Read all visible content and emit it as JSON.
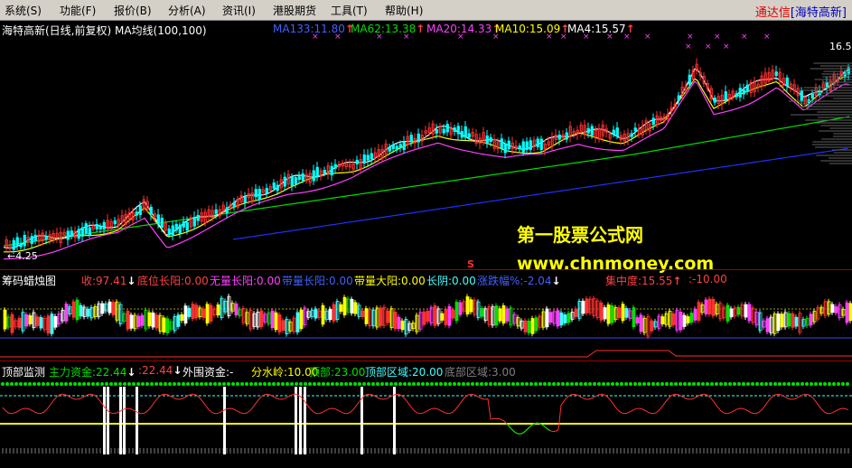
{
  "menu": {
    "items": [
      "系统(S)",
      "功能(F)",
      "报价(B)",
      "分析(A)",
      "资讯(I)",
      "港股期货",
      "工具(T)",
      "帮助(H)"
    ]
  },
  "brand": {
    "app": "通达信",
    "stock": "[海特高新]"
  },
  "main_panel": {
    "title": "海特高新(日线,前复权) MA均线(100,100)",
    "ma": [
      {
        "label": "MA133:11.80",
        "color": "#4060ff",
        "arrow": "↑"
      },
      {
        "label": "MA62:13.38",
        "color": "#00e000",
        "arrow": "↑"
      },
      {
        "label": "MA20:14.33",
        "color": "#ff40ff",
        "arrow": "↑"
      },
      {
        "label": "MA10:15.09",
        "color": "#ffff00",
        "arrow": "↑"
      },
      {
        "label": "MA4:15.57",
        "color": "#ffffff",
        "arrow": "↑"
      }
    ],
    "price_high": "16.5",
    "price_low": "4.25",
    "s_marker": "S",
    "watermark_title": "第一股票公式网",
    "watermark_url": "www.chnmoney.com"
  },
  "mid_panel": {
    "title": "筹码蜡烛图",
    "indicators": [
      {
        "label": "收:97.41",
        "color": "#ff4040",
        "arrow": "↓"
      },
      {
        "label": "底位长阳:0.00",
        "color": "#ff4040",
        "arrow": ""
      },
      {
        "label": "无量长阳:0.00",
        "color": "#ff40ff",
        "arrow": ""
      },
      {
        "label": "带量长阳:0.00",
        "color": "#4060ff",
        "arrow": ""
      },
      {
        "label": "带量大阳:0.00",
        "color": "#ffff00",
        "arrow": ""
      },
      {
        "label": "长阴:0.00",
        "color": "#40ffff",
        "arrow": ""
      },
      {
        "label": "涨跌幅%:-2.04",
        "color": "#4060ff",
        "arrow": "↓"
      },
      {
        "label": "集中度:15.55",
        "color": "#ff4040",
        "arrow": "↑"
      },
      {
        "label": ":-10.00",
        "color": "#ff4040",
        "arrow": ""
      }
    ]
  },
  "bottom_panel": {
    "title": "顶部监测",
    "indicators": [
      {
        "label": "主力资金:22.44",
        "color": "#00e000",
        "arrow": "↓"
      },
      {
        "label": ":22.44",
        "color": "#ff4040",
        "arrow": "↓"
      },
      {
        "label": "外围资金:-",
        "color": "#ffffff",
        "arrow": ""
      },
      {
        "label": "分水岭:10.00",
        "color": "#ffff00",
        "arrow": ""
      },
      {
        "label": "顶部:23.00",
        "color": "#00e000",
        "arrow": ""
      },
      {
        "label": "顶部区域:20.00",
        "color": "#40ffff",
        "arrow": ""
      },
      {
        "label": "底部区域:3.00",
        "color": "#808080",
        "arrow": ""
      }
    ]
  },
  "colors": {
    "up": "#ff3030",
    "down": "#00ffff",
    "ma133": "#2030ff",
    "ma62": "#00e000",
    "ma20": "#ff40ff",
    "ma10": "#ffff00",
    "ma4": "#ffffff"
  }
}
